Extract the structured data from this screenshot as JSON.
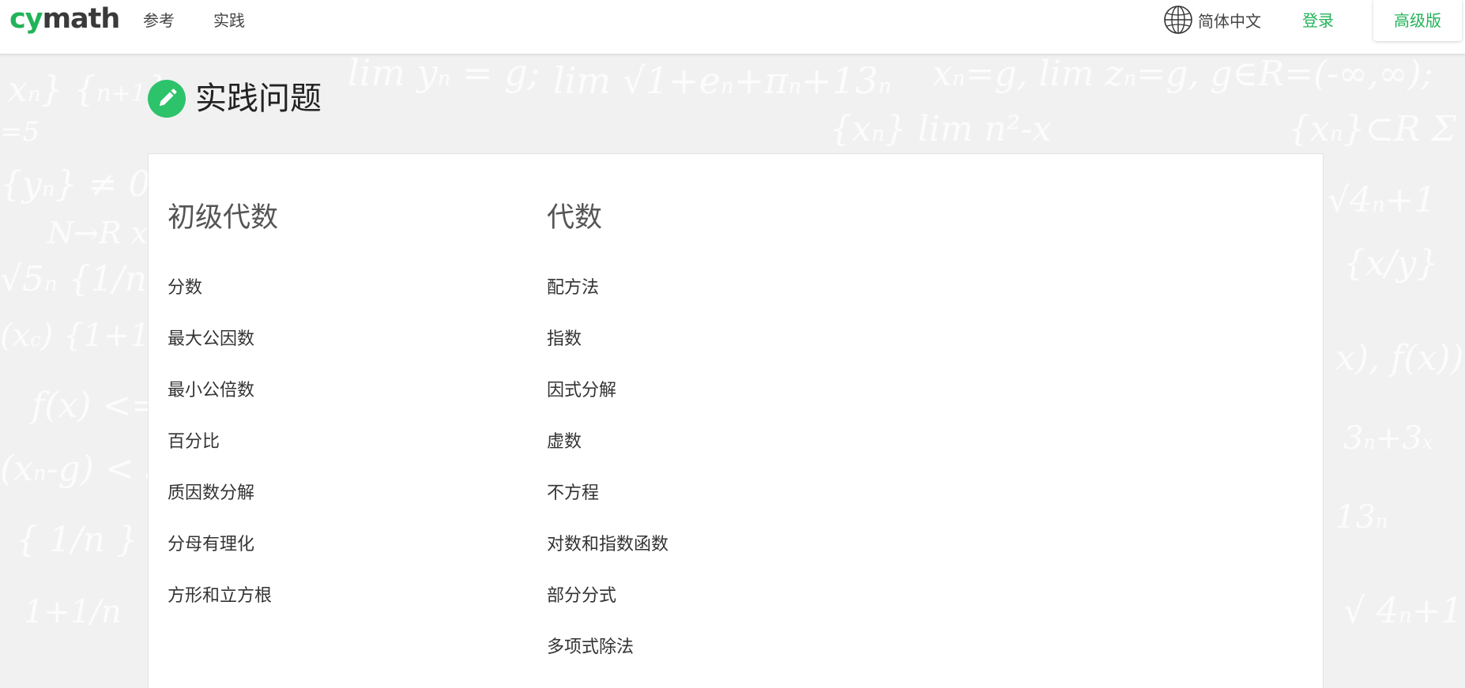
{
  "header": {
    "logo_part1": "cy",
    "logo_part2": "math",
    "nav": [
      {
        "label": "参考"
      },
      {
        "label": "实践"
      }
    ],
    "language": {
      "icon": "globe-icon",
      "label": "简体中文"
    },
    "login_label": "登录",
    "pro_label": "高级版"
  },
  "page": {
    "title": "实践问题",
    "title_icon": "pencil-icon"
  },
  "sections": [
    {
      "title": "初级代数",
      "topics": [
        "分数",
        "最大公因数",
        "最小公倍数",
        "百分比",
        "质因数分解",
        "分母有理化",
        "方形和立方根"
      ]
    },
    {
      "title": "代数",
      "topics": [
        "配方法",
        "指数",
        "因式分解",
        "虚数",
        "不方程",
        "对数和指数函数",
        "部分分式",
        "多项式除法"
      ]
    }
  ],
  "colors": {
    "brand_green": "#22b359",
    "badge_green": "#2dc36b",
    "background": "#f1f1f1"
  }
}
